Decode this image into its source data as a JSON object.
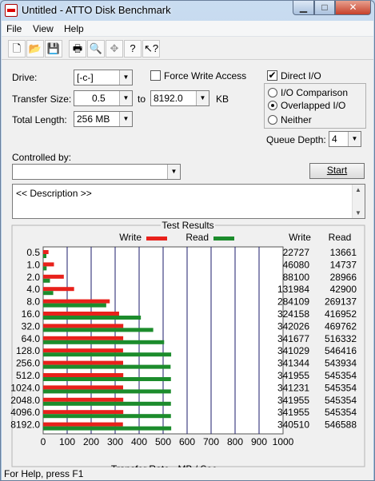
{
  "window": {
    "title": "Untitled - ATTO Disk Benchmark"
  },
  "menu": [
    "File",
    "View",
    "Help"
  ],
  "toolbar_icons": [
    "new-icon",
    "open-icon",
    "save-icon",
    "print-icon",
    "print-preview-icon",
    "move-icon",
    "help-icon",
    "context-help-icon"
  ],
  "form": {
    "drive_label": "Drive:",
    "drive_value": "[-c-]",
    "force_write_label": "Force Write Access",
    "direct_io_label": "Direct I/O",
    "transfer_size_label": "Transfer Size:",
    "transfer_from": "0.5",
    "to_label": "to",
    "transfer_to": "8192.0",
    "kb_label": "KB",
    "total_length_label": "Total Length:",
    "total_length_value": "256 MB",
    "io_comparison_label": "I/O Comparison",
    "overlapped_io_label": "Overlapped I/O",
    "neither_label": "Neither",
    "queue_depth_label": "Queue Depth:",
    "queue_depth_value": "4",
    "controlled_by_label": "Controlled by:",
    "controlled_by_value": "",
    "start_label": "Start",
    "description_text": "<< Description >>"
  },
  "results": {
    "title": "Test Results",
    "write_legend": "Write",
    "read_legend": "Read",
    "write_header": "Write",
    "read_header": "Read"
  },
  "colors": {
    "write": "#e8211b",
    "read": "#1c8c2c",
    "gridline": "#1b1b6b"
  },
  "chart_data": {
    "type": "bar",
    "orientation": "horizontal",
    "categories": [
      "0.5",
      "1.0",
      "2.0",
      "4.0",
      "8.0",
      "16.0",
      "32.0",
      "64.0",
      "128.0",
      "256.0",
      "512.0",
      "1024.0",
      "2048.0",
      "4096.0",
      "8192.0"
    ],
    "series": [
      {
        "name": "Write",
        "values": [
          22727,
          46080,
          88100,
          131984,
          284109,
          324158,
          342026,
          341677,
          341029,
          341344,
          341955,
          341231,
          341955,
          341955,
          340510
        ]
      },
      {
        "name": "Read",
        "values": [
          13661,
          14737,
          28966,
          42900,
          269137,
          416952,
          469762,
          516332,
          546416,
          543934,
          545354,
          545354,
          545354,
          545354,
          546588
        ]
      }
    ],
    "xlabel": "Transfer Rate - MB / Sec",
    "xticks": [
      0,
      100,
      200,
      300,
      400,
      500,
      600,
      700,
      800,
      900,
      1000
    ],
    "xlim": [
      0,
      1000
    ],
    "grid": true,
    "legend": "top"
  },
  "status": {
    "text": "For Help, press F1"
  }
}
